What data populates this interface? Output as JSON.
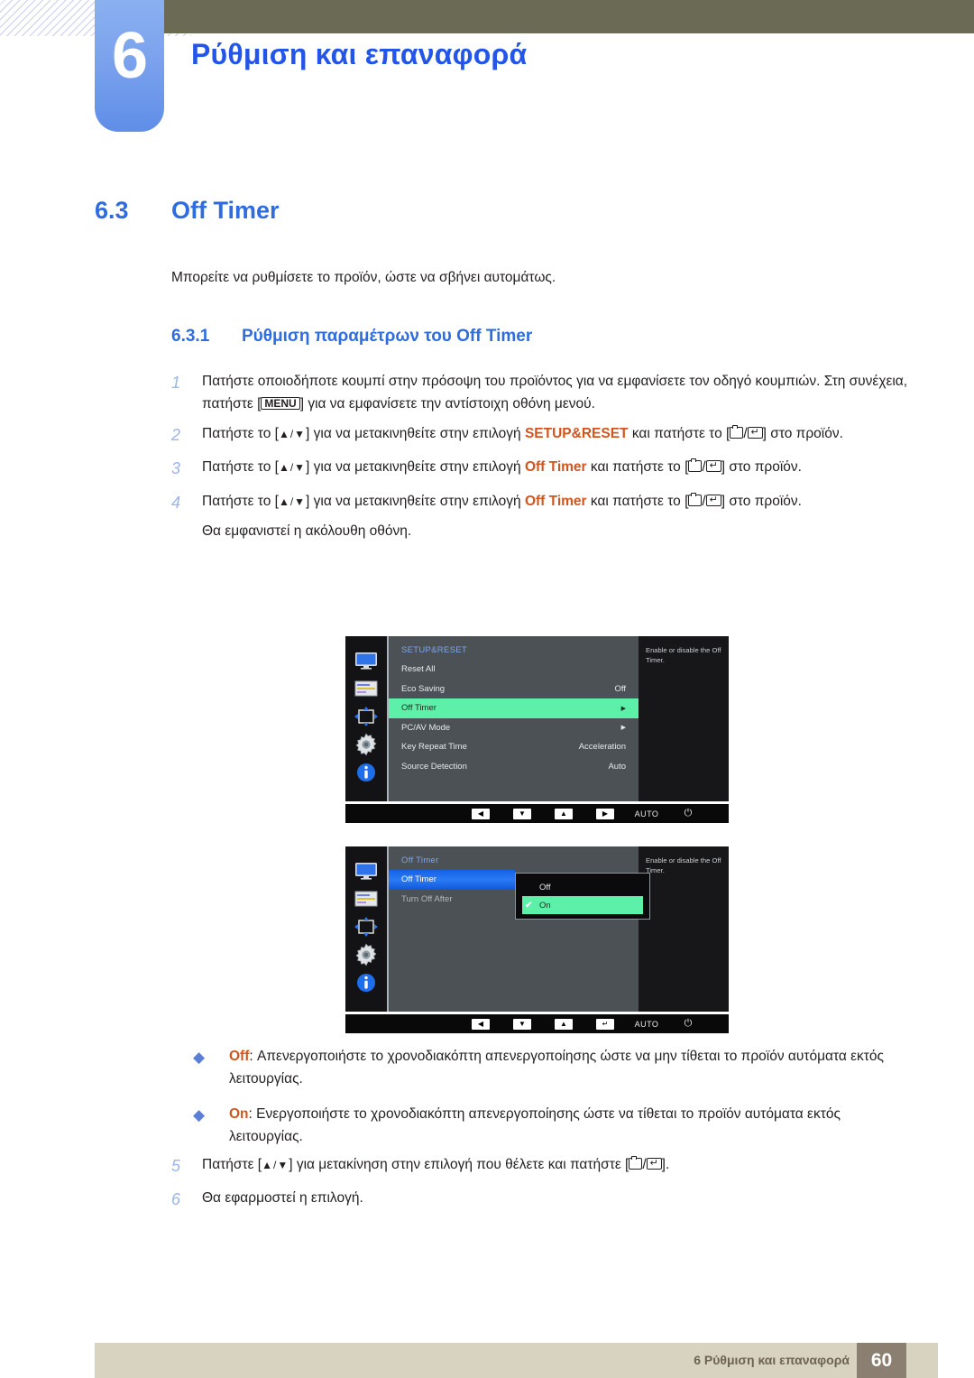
{
  "header": {
    "chapter_number": "6",
    "chapter_title": "Ρύθμιση και επαναφορά"
  },
  "section": {
    "number": "6.3",
    "title": "Off Timer",
    "intro": "Μπορείτε να ρυθμίσετε το προϊόν, ώστε να σβήνει αυτομάτως.",
    "sub_number": "6.3.1",
    "sub_title": "Ρύθμιση παραμέτρων του Off Timer"
  },
  "steps": [
    {
      "num": "1",
      "part1": "Πατήστε οποιοδήποτε κουμπί στην πρόσοψη του προϊόντος για να εμφανίσετε τον οδηγό κουμπιών. Στη συνέχεια, πατήστε [",
      "key": "MENU",
      "part2": "] για να εμφανίσετε την αντίστοιχη οθόνη μενού."
    },
    {
      "num": "2",
      "part1": "Πατήστε το [",
      "arrows": "▲/▼",
      "part2": "] για να μετακινηθείτε στην επιλογή ",
      "accent": "SETUP&RESET",
      "part3": " και πατήστε το [",
      "part4": "] στο προϊόν."
    },
    {
      "num": "3",
      "part1": "Πατήστε το [",
      "arrows": "▲/▼",
      "part2": "] για να μετακινηθείτε στην επιλογή ",
      "accent": "Off Timer",
      "part3": " και πατήστε το [",
      "part4": "] στο προϊόν."
    },
    {
      "num": "4",
      "part1": "Πατήστε το [",
      "arrows": "▲/▼",
      "part2": "] για να μετακινηθείτε στην επιλογή ",
      "accent": "Off Timer",
      "part3": " και πατήστε το [",
      "part4": "] στο προϊόν.",
      "note": "Θα εμφανιστεί η ακόλουθη οθόνη."
    }
  ],
  "steps_bottom": [
    {
      "num": "5",
      "part1": "Πατήστε [",
      "arrows": "▲/▼",
      "part2": "] για μετακίνηση στην επιλογή που θέλετε και πατήστε [",
      "part4": "]."
    },
    {
      "num": "6",
      "part1": "Θα εφαρμοστεί η επιλογή."
    }
  ],
  "bullets": [
    {
      "dot": "◆",
      "accent": "Off",
      "text": ": Απενεργοποιήστε το χρονοδιακόπτη απενεργοποίησης ώστε να μην τίθεται το προϊόν αυτόματα εκτός λειτουργίας."
    },
    {
      "dot": "◆",
      "accent": "On",
      "text": ": Ενεργοποιήστε το χρονοδιακόπτη απενεργοποίησης ώστε να τίθεται το προϊόν αυτόματα εκτός λειτουργίας."
    }
  ],
  "osd1": {
    "title": "SETUP&RESET",
    "help": "Enable or disable the Off Timer.",
    "rows": [
      {
        "label": "Reset All",
        "value": ""
      },
      {
        "label": "Eco Saving",
        "value": "Off"
      },
      {
        "label": "Off Timer",
        "value": "▶",
        "state": "selected-green"
      },
      {
        "label": "PC/AV Mode",
        "value": "▶"
      },
      {
        "label": "Key Repeat Time",
        "value": "Acceleration"
      },
      {
        "label": "Source Detection",
        "value": "Auto"
      }
    ],
    "buttons": [
      {
        "name": "left",
        "glyph": "◀"
      },
      {
        "name": "down",
        "glyph": "▼"
      },
      {
        "name": "up",
        "glyph": "▲"
      },
      {
        "name": "right",
        "glyph": "▶"
      },
      {
        "name": "auto",
        "glyph": "AUTO"
      },
      {
        "name": "power",
        "glyph": "⏻"
      }
    ]
  },
  "osd2": {
    "title": "Off Timer",
    "help": "Enable or disable the Off Timer.",
    "rows": [
      {
        "label": "Off Timer",
        "state": "selected-blue"
      },
      {
        "label": "Turn Off After",
        "state": "dim"
      }
    ],
    "popup": {
      "options": [
        {
          "label": "Off",
          "checked": false
        },
        {
          "label": "On",
          "checked": true,
          "check": "✔"
        }
      ]
    },
    "buttons": [
      {
        "name": "left",
        "glyph": "◀"
      },
      {
        "name": "down",
        "glyph": "▼"
      },
      {
        "name": "up",
        "glyph": "▲"
      },
      {
        "name": "enter",
        "glyph": "↵"
      },
      {
        "name": "auto",
        "glyph": "AUTO"
      },
      {
        "name": "power",
        "glyph": "⏻"
      }
    ]
  },
  "footer": {
    "text": "6 Ρύθμιση και επαναφορά",
    "page": "60"
  }
}
